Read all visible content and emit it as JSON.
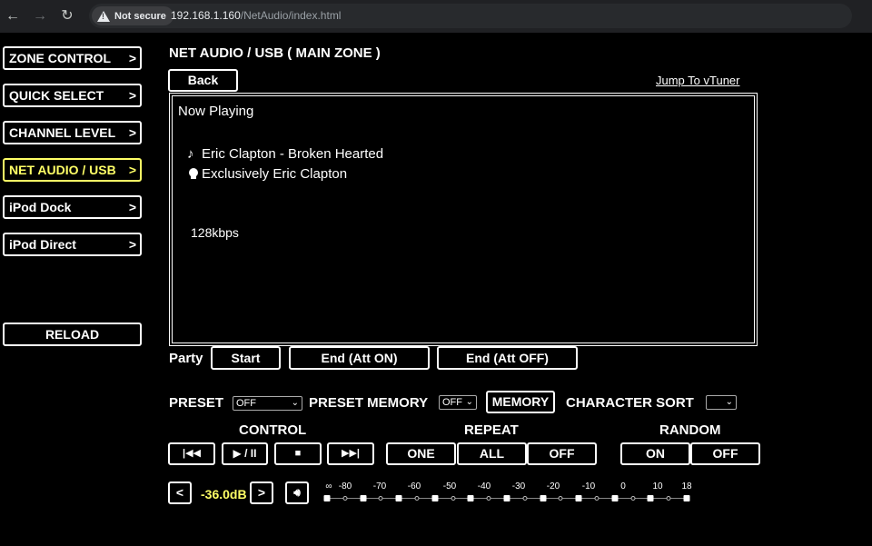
{
  "browser": {
    "security_label": "Not secure",
    "url_host": "192.168.1.160",
    "url_path": "/NetAudio/index.html"
  },
  "sidebar": {
    "items": [
      {
        "label": "ZONE CONTROL",
        "arrow": ">"
      },
      {
        "label": "QUICK SELECT",
        "arrow": ">"
      },
      {
        "label": "CHANNEL LEVEL",
        "arrow": ">"
      },
      {
        "label": "NET AUDIO / USB",
        "arrow": ">"
      },
      {
        "label": "iPod Dock",
        "arrow": ">"
      },
      {
        "label": "iPod Direct",
        "arrow": ">"
      }
    ],
    "active_index": 3,
    "reload_label": "RELOAD"
  },
  "main": {
    "title": "NET AUDIO / USB ( MAIN ZONE )",
    "back_label": "Back",
    "jump_label": "Jump To vTuner",
    "now_playing": {
      "heading": "Now Playing",
      "track": "Eric Clapton - Broken Hearted",
      "album": "Exclusively Eric Clapton",
      "bitrate": "128kbps"
    },
    "party": {
      "label": "Party",
      "start": "Start",
      "end_att_on": "End (Att ON)",
      "end_att_off": "End (Att OFF)"
    },
    "preset": {
      "label": "PRESET",
      "value": "OFF",
      "memory_label": "PRESET MEMORY",
      "memory_value": "OFF",
      "memory_button": "MEMORY",
      "sort_label": "CHARACTER SORT",
      "sort_value": ""
    },
    "control": {
      "label": "CONTROL",
      "prev": "|◀◀",
      "play_pause": "▶ / II",
      "stop": "■",
      "next": "▶▶|"
    },
    "repeat": {
      "label": "REPEAT",
      "one": "ONE",
      "all": "ALL",
      "off": "OFF"
    },
    "random": {
      "label": "RANDOM",
      "on": "ON",
      "off": "OFF"
    },
    "volume": {
      "down": "<",
      "up": ">",
      "value": "-36.0dB",
      "scale_labels": [
        "∞",
        "-80",
        "-70",
        "-60",
        "-50",
        "-40",
        "-30",
        "-20",
        "-10",
        "0",
        "10",
        "18"
      ]
    }
  },
  "colors": {
    "active": "#ffff66",
    "background": "#000000",
    "text": "#ffffff"
  }
}
